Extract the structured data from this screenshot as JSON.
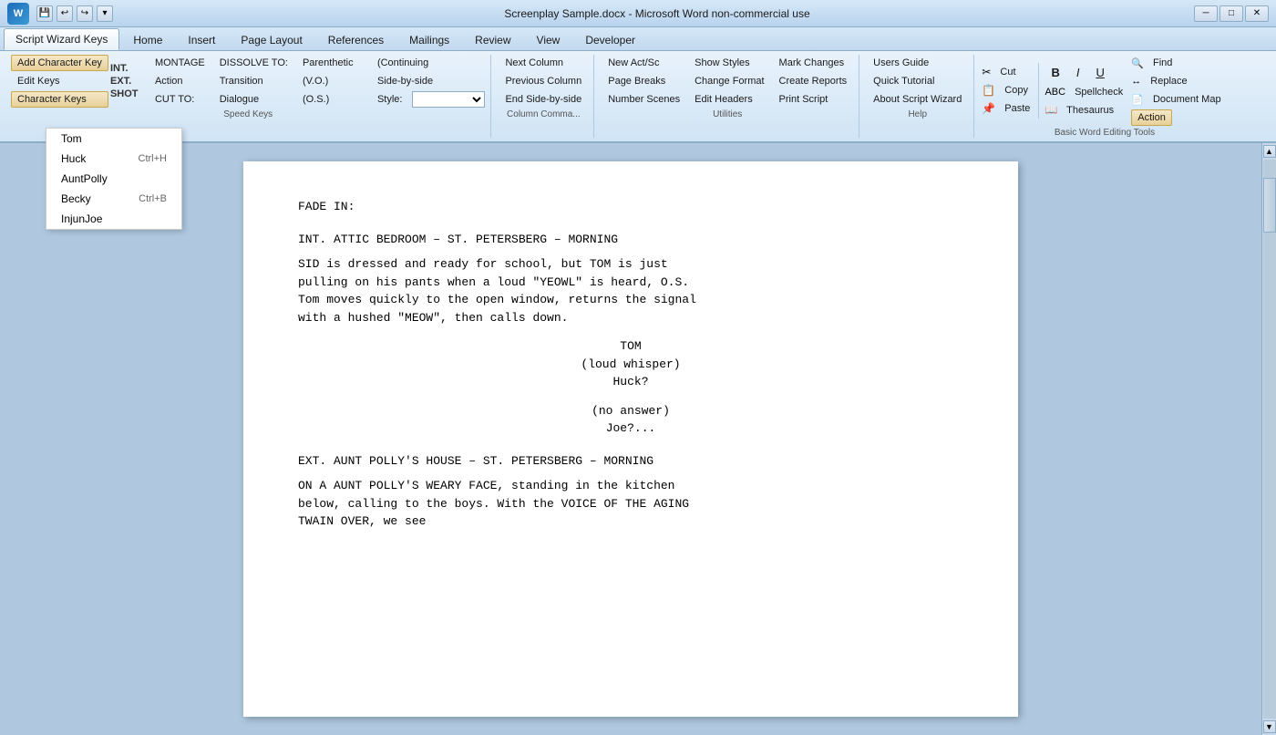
{
  "titlebar": {
    "logo": "W",
    "title": "Screenplay Sample.docx - Microsoft Word non-commercial use",
    "buttons": [
      "─",
      "□",
      "✕"
    ],
    "quickaccess": [
      "💾",
      "↩",
      "↪",
      "⊟"
    ]
  },
  "ribbontabs": {
    "tabs": [
      "Script Wizard Keys",
      "Home",
      "Insert",
      "Page Layout",
      "References",
      "Mailings",
      "Review",
      "View",
      "Developer"
    ],
    "active": "Script Wizard Keys"
  },
  "ribbon": {
    "groups": {
      "addkey": "Add Character Key",
      "editkeys": "Edit Keys",
      "characterkeys_active": "Character Keys",
      "int_label": "INT.",
      "ext_label": "EXT.",
      "shot_label": "SHOT",
      "montage_label": "MONTAGE",
      "action_label": "Action",
      "cutto_label": "CUT TO:",
      "dissolve_label": "DISSOLVE TO:",
      "transition_label": "Transition",
      "dialogue_label": "Dialogue",
      "parenthetic_label": "Parenthetic",
      "vo_label": "(V.O.)",
      "os_label": "(O.S.)",
      "continuing_label": "(Continuing",
      "sidebyside_label": "Side-by-side",
      "style_label": "Style:",
      "style_dropdown": "",
      "nextcol": "Next Column",
      "prevcol": "Previous Column",
      "endsidebyside": "End Side-by-side",
      "columncmds": "Column Comma...",
      "newactsc": "New Act/Sc",
      "pagebreaks": "Page Breaks",
      "numscenes": "Number Scenes",
      "showtyles": "Show Styles",
      "changeformat": "Change Format",
      "editheaders": "Edit Headers",
      "markchanges": "Mark Changes",
      "createreports": "Create Reports",
      "printscript": "Print Script",
      "usersguide": "Users Guide",
      "quicktutorial": "Quick Tutorial",
      "aboutscriptwizard": "About Script Wizard",
      "cut": "Cut",
      "copy": "Copy",
      "paste": "Paste",
      "spellcheck": "Spellcheck",
      "thesaurus": "Thesaurus",
      "replace": "Replace",
      "find": "Find",
      "documentmap": "Document Map",
      "action_tab": "Action",
      "speedkeys_label": "Speed Keys",
      "columncomma_label": "Column Comma...",
      "utilities_label": "Utilities",
      "help_label": "Help",
      "basicword_label": "Basic Word Editing Tools"
    }
  },
  "dropdown": {
    "items": [
      {
        "name": "Tom",
        "shortcut": ""
      },
      {
        "name": "Huck",
        "shortcut": "Ctrl+H"
      },
      {
        "name": "AuntPolly",
        "shortcut": ""
      },
      {
        "name": "Becky",
        "shortcut": "Ctrl+B"
      },
      {
        "name": "InjunJoe",
        "shortcut": ""
      }
    ]
  },
  "document": {
    "fadein": "FADE IN:",
    "scene1": "INT. ATTIC BEDROOM – ST. PETERSBERG – MORNING",
    "action1": "SID is dressed and ready for school, but TOM is just\npulling on his pants when a loud \"YEOWL\" is heard, O.S.\nTom moves quickly to the open window, returns the signal\nwith a hushed \"MEOW\", then calls down.",
    "char1": "TOM",
    "parent1": "(loud whisper)",
    "dial1": "Huck?",
    "parent2": "(no answer)",
    "dial2": "Joe?...",
    "scene2": "EXT.  AUNT POLLY'S HOUSE – ST. PETERSBERG – MORNING",
    "action2": "ON A AUNT POLLY'S WEARY FACE, standing in the kitchen\nbelow, calling to the boys. With the VOICE OF THE AGING\nTWAIN OVER, we see"
  }
}
